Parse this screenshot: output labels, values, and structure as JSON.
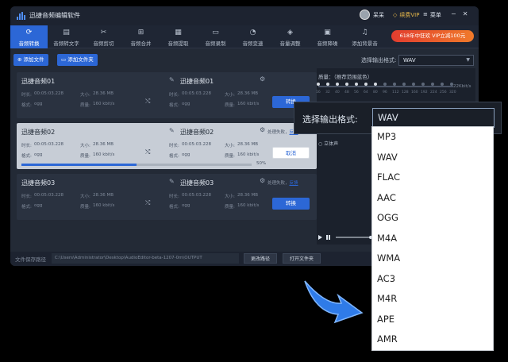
{
  "app": {
    "title": "迅捷音频编辑软件",
    "user_name": "呆呆",
    "vip_label": "续费VIP",
    "menu_label": "菜单"
  },
  "tabs": [
    {
      "label": "音频转换",
      "icon": "refresh-icon"
    },
    {
      "label": "音频转文字",
      "icon": "audio-to-text-icon"
    },
    {
      "label": "音频剪切",
      "icon": "scissors-icon"
    },
    {
      "label": "音频合并",
      "icon": "merge-icon"
    },
    {
      "label": "音频提取",
      "icon": "extract-icon"
    },
    {
      "label": "音频录制",
      "icon": "record-icon"
    },
    {
      "label": "音频变速",
      "icon": "speed-icon"
    },
    {
      "label": "音量调整",
      "icon": "volume-icon"
    },
    {
      "label": "音频降噪",
      "icon": "denoise-icon"
    },
    {
      "label": "添加背景音",
      "icon": "background-music-icon"
    }
  ],
  "promo": "618年中狂欢 VIP立减100元",
  "toolbar": {
    "add_file": "添加文件",
    "add_folder": "添加文件夹",
    "format_label": "选择输出格式:",
    "format_value": "WAV"
  },
  "files": [
    {
      "name": "迅捷音频01",
      "output": "迅捷音频01",
      "duration_label": "时长:",
      "duration": "00:05:03.228",
      "size_label": "大小:",
      "size": "28.36 MB",
      "format_label": "格式:",
      "format": "ogg",
      "bitrate_label": "质量:",
      "bitrate": "160 kbit/s",
      "out_duration": "00:05:03.228",
      "out_size": "28.36 MB",
      "out_format": "ogg",
      "out_bitrate": "160 kbit/s",
      "action": "转换"
    },
    {
      "name": "迅捷音频02",
      "output": "迅捷音频02",
      "duration_label": "时长:",
      "duration": "00:05:03.228",
      "size_label": "大小:",
      "size": "28.36 MB",
      "format_label": "格式:",
      "format": "ogg",
      "bitrate_label": "质量:",
      "bitrate": "160 kbit/s",
      "out_duration": "00:05:03.228",
      "out_size": "28.36 MB",
      "out_format": "ogg",
      "out_bitrate": "160 kbit/s",
      "action": "取消",
      "fail_text": "处理失败，",
      "fail_link": "反馈",
      "progress": 0.5,
      "progress_label": "50%"
    },
    {
      "name": "迅捷音频03",
      "output": "迅捷音频03",
      "duration_label": "时长:",
      "duration": "00:05:03.228",
      "size_label": "大小:",
      "size": "28.36 MB",
      "format_label": "格式:",
      "format": "ogg",
      "bitrate_label": "质量:",
      "bitrate": "160 kbit/s",
      "out_duration": "00:05:03.228",
      "out_size": "28.36 MB",
      "out_format": "ogg",
      "out_bitrate": "160 kbit/s",
      "action": "转换",
      "fail_text": "处理失败，",
      "fail_link": "反馈"
    }
  ],
  "quality": {
    "label": "质量：（推荐范围蓝色）",
    "rate": "22Kbit/s",
    "ticks": [
      "16",
      "32",
      "40",
      "48",
      "56",
      "64",
      "80",
      "96",
      "112",
      "128",
      "160",
      "192",
      "224",
      "256",
      "320"
    ],
    "selected_count": 7
  },
  "stereo_label": "立体声",
  "bottom": {
    "save_label": "文件保存路径",
    "path": "C:\\Users\\Administrator\\Desktop\\AudioEditor-beta-1207-0m\\OUTPUT",
    "change_path": "更改路径",
    "open_folder": "打开文件夹"
  },
  "popup": {
    "label": "选择输出格式:",
    "value": "WAV"
  },
  "dropdown_options": [
    "MP3",
    "WAV",
    "FLAC",
    "AAC",
    "OGG",
    "M4A",
    "WMA",
    "AC3",
    "M4R",
    "APE",
    "AMR"
  ]
}
